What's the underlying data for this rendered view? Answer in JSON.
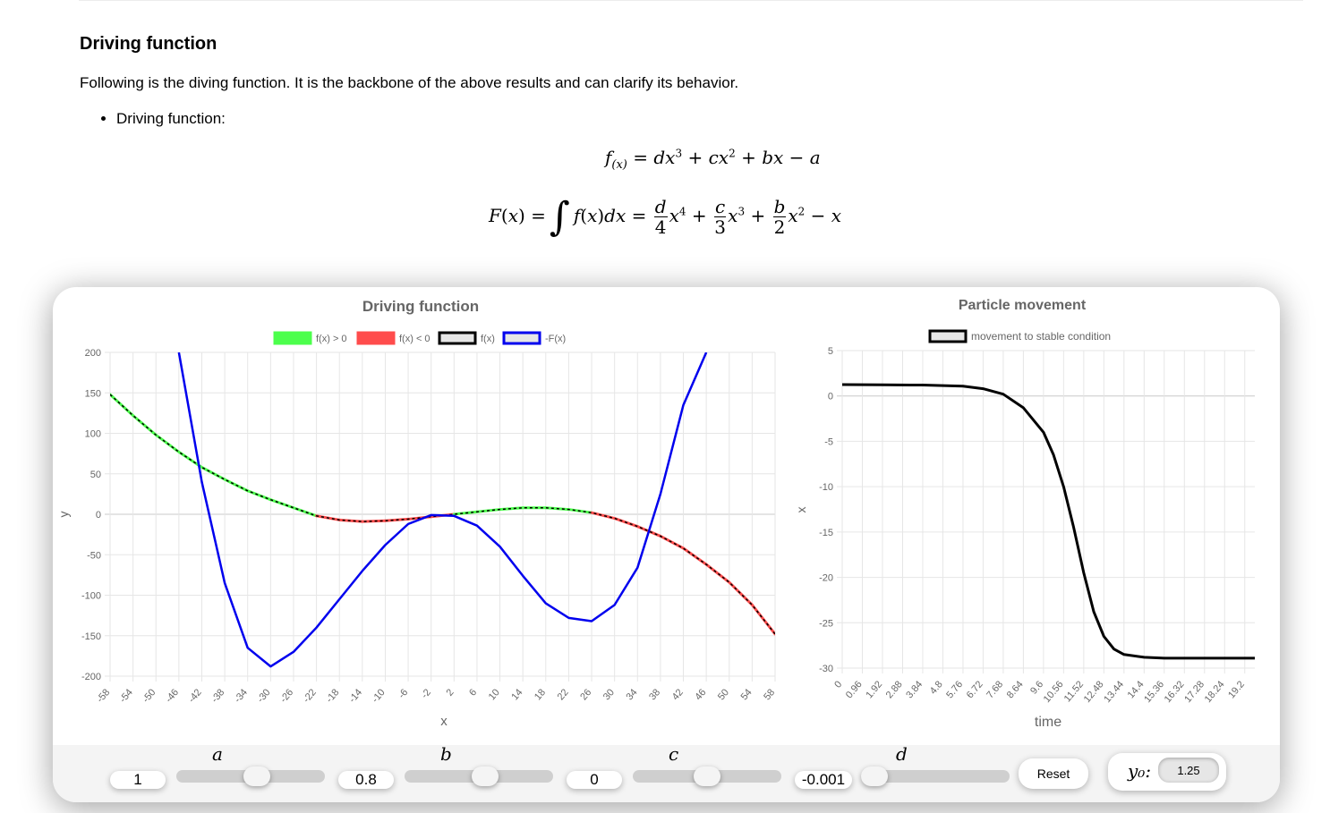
{
  "section": {
    "title": "Driving function",
    "intro": "Following is the diving function. It is the backbone of the above results and can clarify its behavior.",
    "bullet": "Driving function:"
  },
  "colors": {
    "positive": "#4cff4c",
    "negative": "#ff4c4c",
    "fx": "#000000",
    "neg_F": "#0000ee",
    "movement": "#000000"
  },
  "controls": {
    "a_label": "a",
    "a_value": "1",
    "a_fraction": 0.55,
    "b_label": "b",
    "b_value": "0.8",
    "b_fraction": 0.55,
    "c_label": "c",
    "c_value": "0",
    "c_fraction": 0.5,
    "d_label": "d",
    "d_value": "-0.001",
    "d_fraction": 0.0,
    "reset_label": "Reset",
    "y0_label": "y₀:",
    "y0_value": "1.25"
  },
  "chart_data": [
    {
      "type": "line",
      "title": "Driving function",
      "xlabel": "x",
      "ylabel": "y",
      "legend": [
        "f(x) > 0",
        "f(x) < 0",
        "f(x)",
        "-F(x)"
      ],
      "legend_position": "top",
      "grid": true,
      "xlim": [
        -58,
        58
      ],
      "ylim": [
        -200,
        200
      ],
      "x_ticks": [
        "-58",
        "-54",
        "-50",
        "-46",
        "-42",
        "-38",
        "-34",
        "-30",
        "-26",
        "-22",
        "-18",
        "-14",
        "-10",
        "-6",
        "-2",
        "2",
        "6",
        "10",
        "14",
        "18",
        "22",
        "26",
        "30",
        "34",
        "38",
        "42",
        "46",
        "50",
        "54",
        "58"
      ],
      "y_ticks": [
        "200",
        "150",
        "100",
        "50",
        "0",
        "-50",
        "-100",
        "-150",
        "-200"
      ],
      "series": [
        {
          "name": "f(x)",
          "x": [
            -58,
            -54,
            -50,
            -46,
            -42,
            -38,
            -34,
            -30,
            -26,
            -22,
            -18,
            -14,
            -10,
            -6,
            -2,
            2,
            6,
            10,
            14,
            18,
            22,
            26,
            30,
            34,
            38,
            42,
            46,
            50,
            54,
            58
          ],
          "values": [
            148,
            122,
            98,
            77,
            58,
            43,
            29,
            18,
            8,
            -2,
            -7,
            -9,
            -8,
            -6,
            -3,
            0,
            3,
            6,
            8,
            8,
            6,
            2,
            -5,
            -15,
            -27,
            -42,
            -62,
            -84,
            -112,
            -148
          ]
        },
        {
          "name": "-F(x)",
          "x": [
            -46,
            -42,
            -38,
            -34,
            -30,
            -26,
            -22,
            -18,
            -14,
            -10,
            -6,
            -2,
            2,
            6,
            10,
            14,
            18,
            22,
            26,
            30,
            34,
            38,
            42,
            46
          ],
          "values": [
            200,
            40,
            -85,
            -165,
            -188,
            -170,
            -140,
            -105,
            -70,
            -38,
            -12,
            -1,
            -2,
            -14,
            -40,
            -76,
            -110,
            -128,
            -132,
            -112,
            -66,
            25,
            135,
            200
          ]
        }
      ]
    },
    {
      "type": "line",
      "title": "Particle movement",
      "xlabel": "time",
      "ylabel": "x",
      "legend": [
        "movement to stable condition"
      ],
      "legend_position": "top",
      "grid": true,
      "ylim": [
        -30,
        5
      ],
      "x_ticks": [
        "0",
        "0.96",
        "1.92",
        "2.88",
        "3.84",
        "4.8",
        "5.76",
        "6.72",
        "7.68",
        "8.64",
        "9.6",
        "10.56",
        "11.52",
        "12.48",
        "13.44",
        "14.4",
        "15.36",
        "16.32",
        "17.28",
        "18.24",
        "19.2"
      ],
      "y_ticks": [
        "5",
        "0",
        "-5",
        "-10",
        "-15",
        "-20",
        "-25",
        "-30"
      ],
      "series": [
        {
          "name": "movement to stable condition",
          "x": [
            0,
            1.92,
            3.84,
            5.76,
            6.72,
            7.68,
            8.64,
            9.6,
            10.08,
            10.56,
            11.04,
            11.52,
            12.0,
            12.48,
            12.96,
            13.44,
            14.4,
            15.36,
            17.28,
            19.68
          ],
          "values": [
            1.25,
            1.23,
            1.2,
            1.08,
            0.8,
            0.2,
            -1.3,
            -4.0,
            -6.5,
            -10,
            -14.5,
            -19.5,
            -23.8,
            -26.5,
            -27.9,
            -28.5,
            -28.8,
            -28.9,
            -28.9,
            -28.9
          ]
        }
      ]
    }
  ]
}
